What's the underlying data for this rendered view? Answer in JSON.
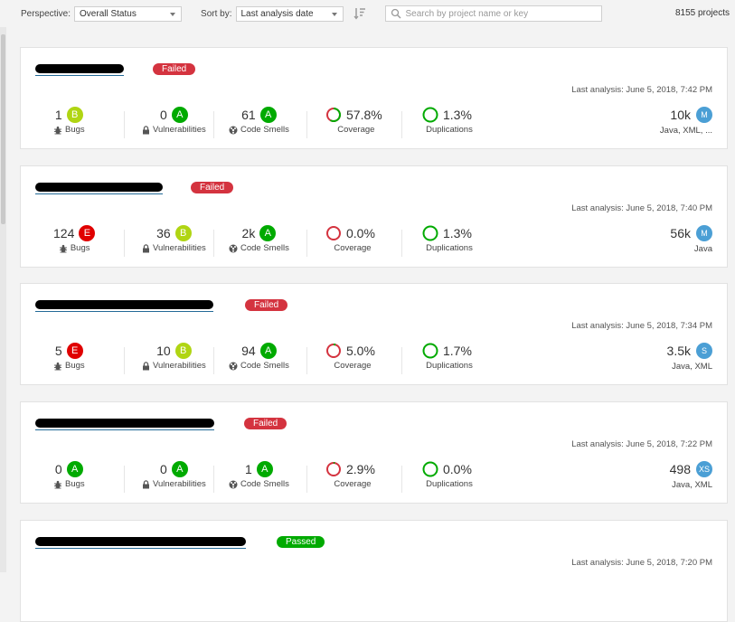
{
  "toolbar": {
    "perspective_label": "Perspective:",
    "perspective_value": "Overall Status",
    "sort_label": "Sort by:",
    "sort_value": "Last analysis date",
    "search_placeholder": "Search by project name or key",
    "project_count": "8155 projects"
  },
  "colors": {
    "A": "#00aa00",
    "B": "#b0d513",
    "C": "#eabe06",
    "D": "#ed7d20",
    "E": "#e00000",
    "failed": "#d4333f",
    "passed": "#00aa00",
    "link": "#236a97",
    "size_badge": "#4b9fd5"
  },
  "labels": {
    "bugs": "Bugs",
    "vulnerabilities": "Vulnerabilities",
    "code_smells": "Code Smells",
    "coverage": "Coverage",
    "duplications": "Duplications"
  },
  "projects": [
    {
      "name": "",
      "quality_gate": "Failed",
      "last_analysis": "Last analysis: June 5, 2018, 7:42 PM",
      "bugs": "1",
      "bugs_rating": "B",
      "vulnerabilities": "0",
      "vulnerabilities_rating": "A",
      "code_smells": "61",
      "code_smells_rating": "A",
      "coverage": "57.8%",
      "coverage_fraction": 0.578,
      "duplications": "1.3%",
      "size": "10k",
      "size_rating": "M",
      "languages": "Java, XML, ..."
    },
    {
      "name": "",
      "quality_gate": "Failed",
      "last_analysis": "Last analysis: June 5, 2018, 7:40 PM",
      "bugs": "124",
      "bugs_rating": "E",
      "vulnerabilities": "36",
      "vulnerabilities_rating": "B",
      "code_smells": "2k",
      "code_smells_rating": "A",
      "coverage": "0.0%",
      "coverage_fraction": 0.0,
      "duplications": "1.3%",
      "size": "56k",
      "size_rating": "M",
      "languages": "Java"
    },
    {
      "name": "",
      "quality_gate": "Failed",
      "last_analysis": "Last analysis: June 5, 2018, 7:34 PM",
      "bugs": "5",
      "bugs_rating": "E",
      "vulnerabilities": "10",
      "vulnerabilities_rating": "B",
      "code_smells": "94",
      "code_smells_rating": "A",
      "coverage": "5.0%",
      "coverage_fraction": 0.05,
      "duplications": "1.7%",
      "size": "3.5k",
      "size_rating": "S",
      "languages": "Java, XML"
    },
    {
      "name": "",
      "quality_gate": "Failed",
      "last_analysis": "Last analysis: June 5, 2018, 7:22 PM",
      "bugs": "0",
      "bugs_rating": "A",
      "vulnerabilities": "0",
      "vulnerabilities_rating": "A",
      "code_smells": "1",
      "code_smells_rating": "A",
      "coverage": "2.9%",
      "coverage_fraction": 0.029,
      "duplications": "0.0%",
      "size": "498",
      "size_rating": "XS",
      "languages": "Java, XML"
    },
    {
      "name": "",
      "quality_gate": "Passed",
      "last_analysis": "Last analysis: June 5, 2018, 7:20 PM"
    }
  ]
}
